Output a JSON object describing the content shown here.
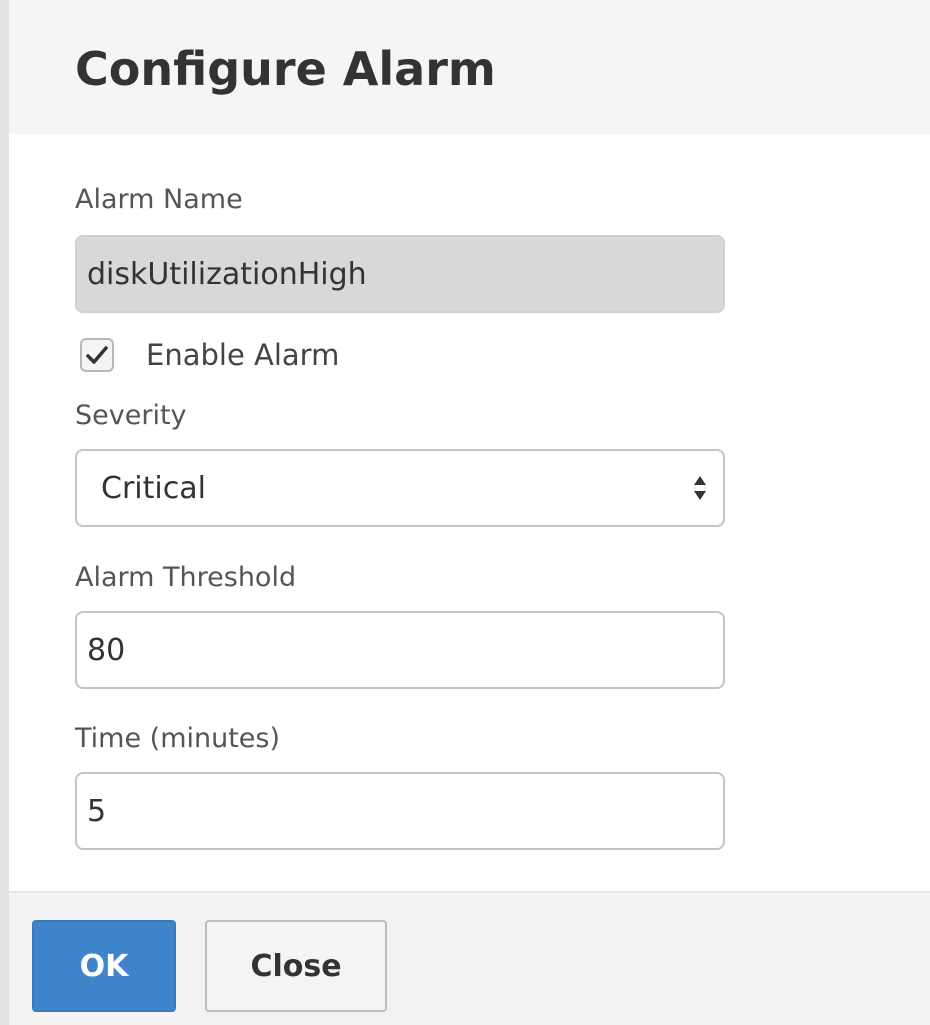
{
  "dialog": {
    "title": "Configure Alarm"
  },
  "form": {
    "alarm_name": {
      "label": "Alarm Name",
      "value": "diskUtilizationHigh"
    },
    "enable_alarm": {
      "label": "Enable Alarm",
      "checked": true
    },
    "severity": {
      "label": "Severity",
      "selected": "Critical"
    },
    "alarm_threshold": {
      "label": "Alarm Threshold",
      "value": "80"
    },
    "time_minutes": {
      "label": "Time (minutes)",
      "value": "5"
    }
  },
  "footer": {
    "ok_label": "OK",
    "close_label": "Close"
  },
  "colors": {
    "primary_button": "#3f85cc",
    "readonly_field": "#d8d8d8"
  },
  "icons": {
    "checkbox": "check-icon",
    "select_arrows": "select-arrows-icon"
  }
}
